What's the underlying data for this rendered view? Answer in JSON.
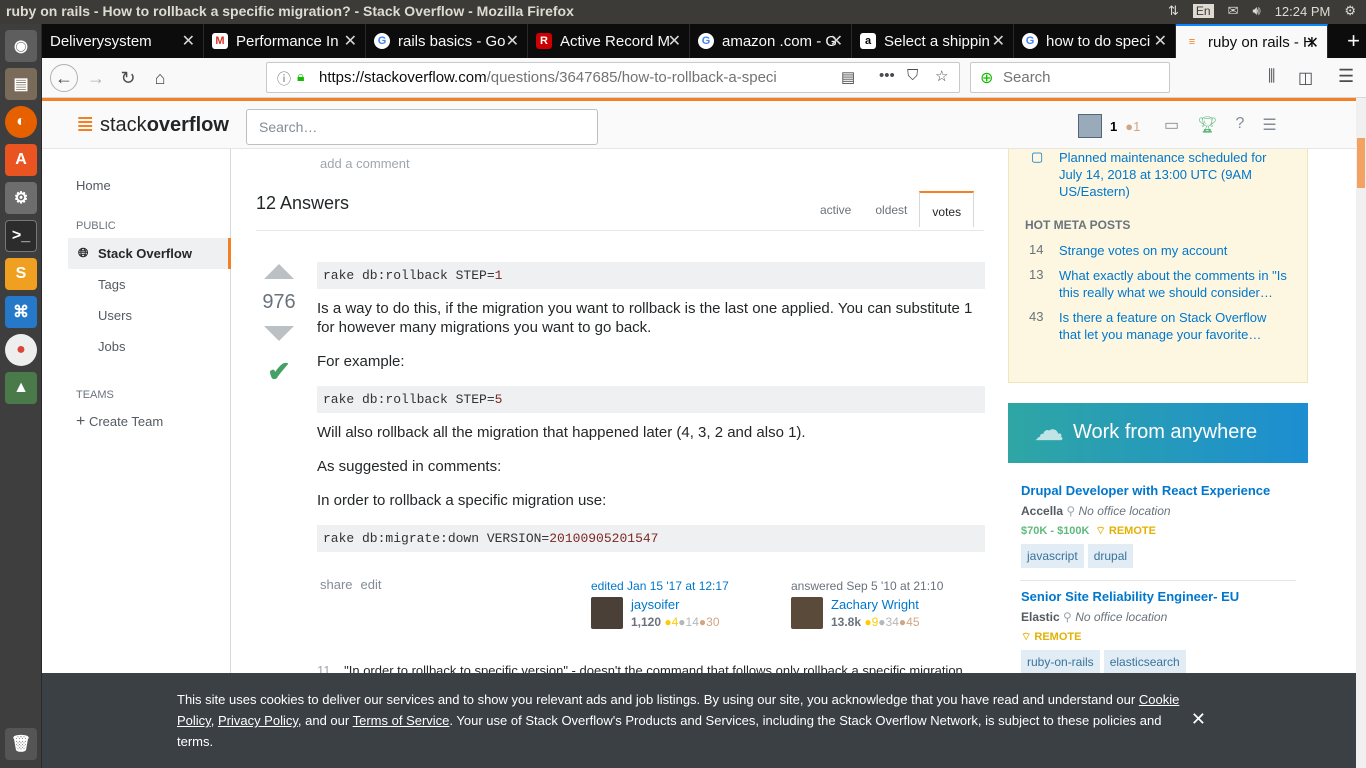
{
  "os": {
    "window_title": "ruby on rails - How to rollback a specific migration? - Stack Overflow - Mozilla Firefox",
    "lang": "En",
    "clock": "12:24 PM"
  },
  "tabs": [
    {
      "label": "Deliverysystem"
    },
    {
      "label": "Performance In"
    },
    {
      "label": "rails basics - Go"
    },
    {
      "label": "Active Record M"
    },
    {
      "label": "amazon .com - G"
    },
    {
      "label": "Select a shippin"
    },
    {
      "label": "how to do speci"
    },
    {
      "label": "ruby on rails - H"
    }
  ],
  "navbar": {
    "url_host": "https://stackoverflow.com",
    "url_path": "/questions/3647685/how-to-rollback-a-speci",
    "search_placeholder": "Search"
  },
  "so": {
    "logo_a": "stack",
    "logo_b": "overflow",
    "search_placeholder": "Search…",
    "rep": "1",
    "badge": "●1"
  },
  "leftnav": {
    "home": "Home",
    "public": "PUBLIC",
    "stack_overflow": "Stack Overflow",
    "tags": "Tags",
    "users": "Users",
    "jobs": "Jobs",
    "teams": "TEAMS",
    "create_team": "Create Team"
  },
  "main": {
    "add_comment": "add a comment",
    "answers_heading": "12 Answers",
    "sort": {
      "active": "active",
      "oldest": "oldest",
      "votes": "votes"
    },
    "votes": "976",
    "code1_prefix": "rake db:rollback STEP=",
    "code1_num": "1",
    "p1": "Is a way to do this, if the migration you want to rollback is the last one applied. You can substitute 1 for however many migrations you want to go back.",
    "p2": "For example:",
    "code2_prefix": "rake db:rollback STEP=",
    "code2_num": "5",
    "p3": "Will also rollback all the migration that happened later (4, 3, 2 and also 1).",
    "p4": "As suggested in comments:",
    "p5": "In order to rollback a specific migration use:",
    "code3_prefix": "rake db:migrate:down VERSION=",
    "code3_num": "20100905201547",
    "share": "share",
    "edit": "edit",
    "editor": {
      "when": "edited Jan 15 '17 at 12:17",
      "name": "jaysoifer",
      "rep": "1,120",
      "gold": "●4",
      "silver": "●14",
      "bronze": "●30"
    },
    "answerer": {
      "when": "answered Sep 5 '10 at 21:10",
      "name": "Zachary Wright",
      "rep": "13.8k",
      "gold": "●9",
      "silver": "●34",
      "bronze": "●45"
    },
    "comment_num": "11",
    "comment_text": "\"In order to rollback to specific version\" - doesn't the command that follows only rollback a specific migration"
  },
  "sidebar": {
    "maintenance": "Planned maintenance scheduled for July 14, 2018 at 13:00 UTC (9AM US/Eastern)",
    "hot_meta_heading": "HOT META POSTS",
    "hot_meta": [
      {
        "count": "14",
        "text": "Strange votes on my account"
      },
      {
        "count": "13",
        "text": "What exactly about the comments in \"Is this really what we should consider…"
      },
      {
        "count": "43",
        "text": "Is there a feature on Stack Overflow that let you manage your favorite…"
      }
    ],
    "jobs_heading": "Work from anywhere",
    "jobs": [
      {
        "title": "Drupal Developer with React Experience",
        "company": "Accella",
        "location": "No office location",
        "salary": "$70K - $100K",
        "remote": "REMOTE",
        "tags": [
          "javascript",
          "drupal"
        ]
      },
      {
        "title": "Senior Site Reliability Engineer- EU",
        "company": "Elastic",
        "location": "No office location",
        "salary": "",
        "remote": "REMOTE",
        "tags": [
          "ruby-on-rails",
          "elasticsearch"
        ]
      }
    ]
  },
  "cookie": {
    "text1": "This site uses cookies to deliver our services and to show you relevant ads and job listings. By using our site, you acknowledge that you have read and understand our ",
    "cookie_policy": "Cookie Policy",
    "sep1": ", ",
    "privacy_policy": "Privacy Policy",
    "sep2": ", and our ",
    "terms": "Terms of Service",
    "text2": ". Your use of Stack Overflow's Products and Services, including the Stack Overflow Network, is subject to these policies and terms.",
    "close": "✕"
  }
}
